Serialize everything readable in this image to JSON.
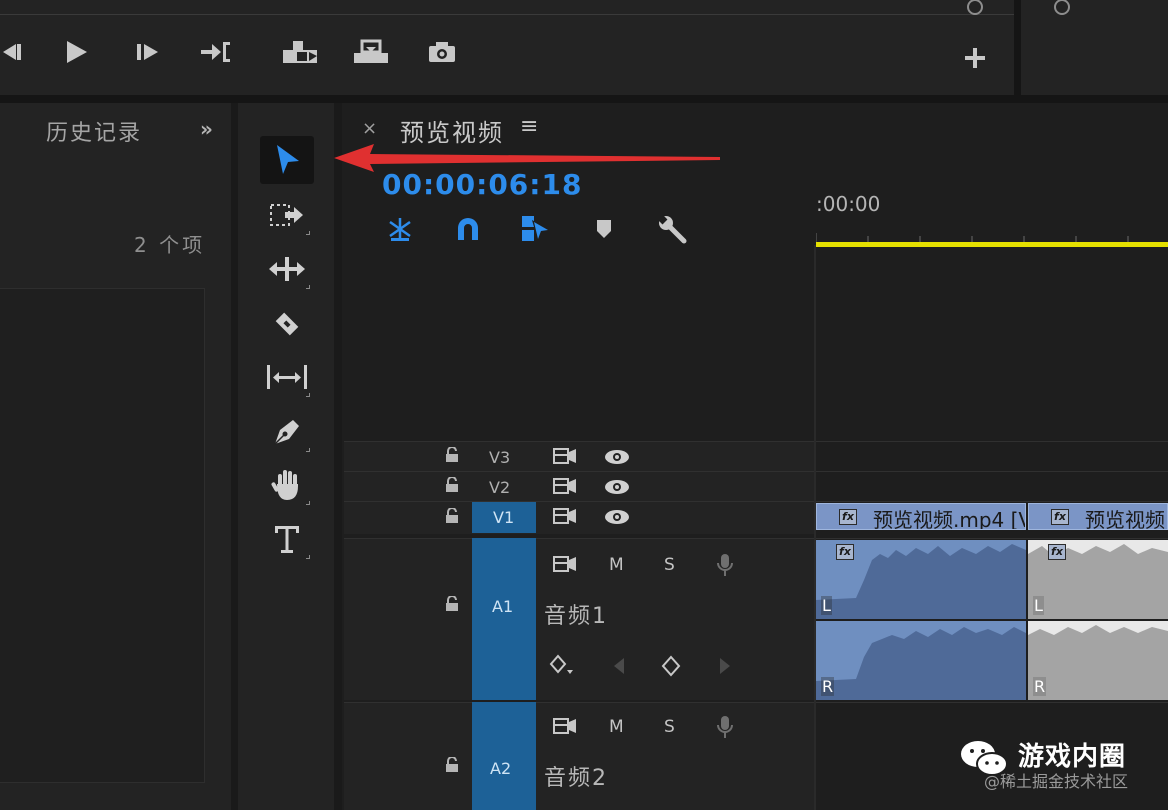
{
  "app": {
    "accent_color": "#2d8ceb",
    "timeline_yellow": "#e5e000",
    "track_blue": "#1d6197"
  },
  "program_monitor": {
    "buttons": [
      {
        "icon": "step-back-icon"
      },
      {
        "icon": "play-icon"
      },
      {
        "icon": "step-forward-icon"
      },
      {
        "icon": "go-to-out-icon"
      },
      {
        "icon": "insert-icon"
      },
      {
        "icon": "overwrite-icon"
      },
      {
        "icon": "export-frame-camera-icon"
      }
    ],
    "add_icon": "plus-icon"
  },
  "history": {
    "title": "历史记录",
    "more": "»",
    "count": "2 个项"
  },
  "tools": [
    {
      "icon": "selection-arrow-icon",
      "active": true
    },
    {
      "icon": "track-select-forward-icon"
    },
    {
      "icon": "ripple-edit-icon"
    },
    {
      "icon": "razor-icon"
    },
    {
      "icon": "slip-icon"
    },
    {
      "icon": "pen-icon"
    },
    {
      "icon": "hand-icon"
    },
    {
      "icon": "type-icon",
      "label": "T"
    }
  ],
  "timeline": {
    "close": "×",
    "title": "预览视频",
    "menu": "≡",
    "timecode": "00:00:06:18",
    "ruler_time": ":00:00",
    "toolbar": [
      {
        "icon": "nest-sequence-icon"
      },
      {
        "icon": "snap-magnet-icon"
      },
      {
        "icon": "linked-selection-icon"
      },
      {
        "icon": "add-marker-icon"
      },
      {
        "icon": "settings-wrench-icon"
      }
    ],
    "video_tracks": [
      {
        "label": "V3"
      },
      {
        "label": "V2"
      },
      {
        "label": "V1",
        "target": "V1"
      }
    ],
    "audio_tracks": [
      {
        "target": "A1",
        "m": "M",
        "s": "S",
        "name": "音频1"
      },
      {
        "target": "A2",
        "m": "M",
        "s": "S",
        "name": "音频2"
      }
    ],
    "video_clips": [
      {
        "fx": "fx",
        "name": "预览视频.mp4 [V"
      },
      {
        "fx": "fx",
        "name": "预览视频"
      }
    ],
    "audio_channels": {
      "left": "L",
      "right": "R"
    },
    "audio_fx": "fx"
  },
  "watermark": {
    "title": "游戏内圈",
    "sub": "@稀土掘金技术社区"
  }
}
